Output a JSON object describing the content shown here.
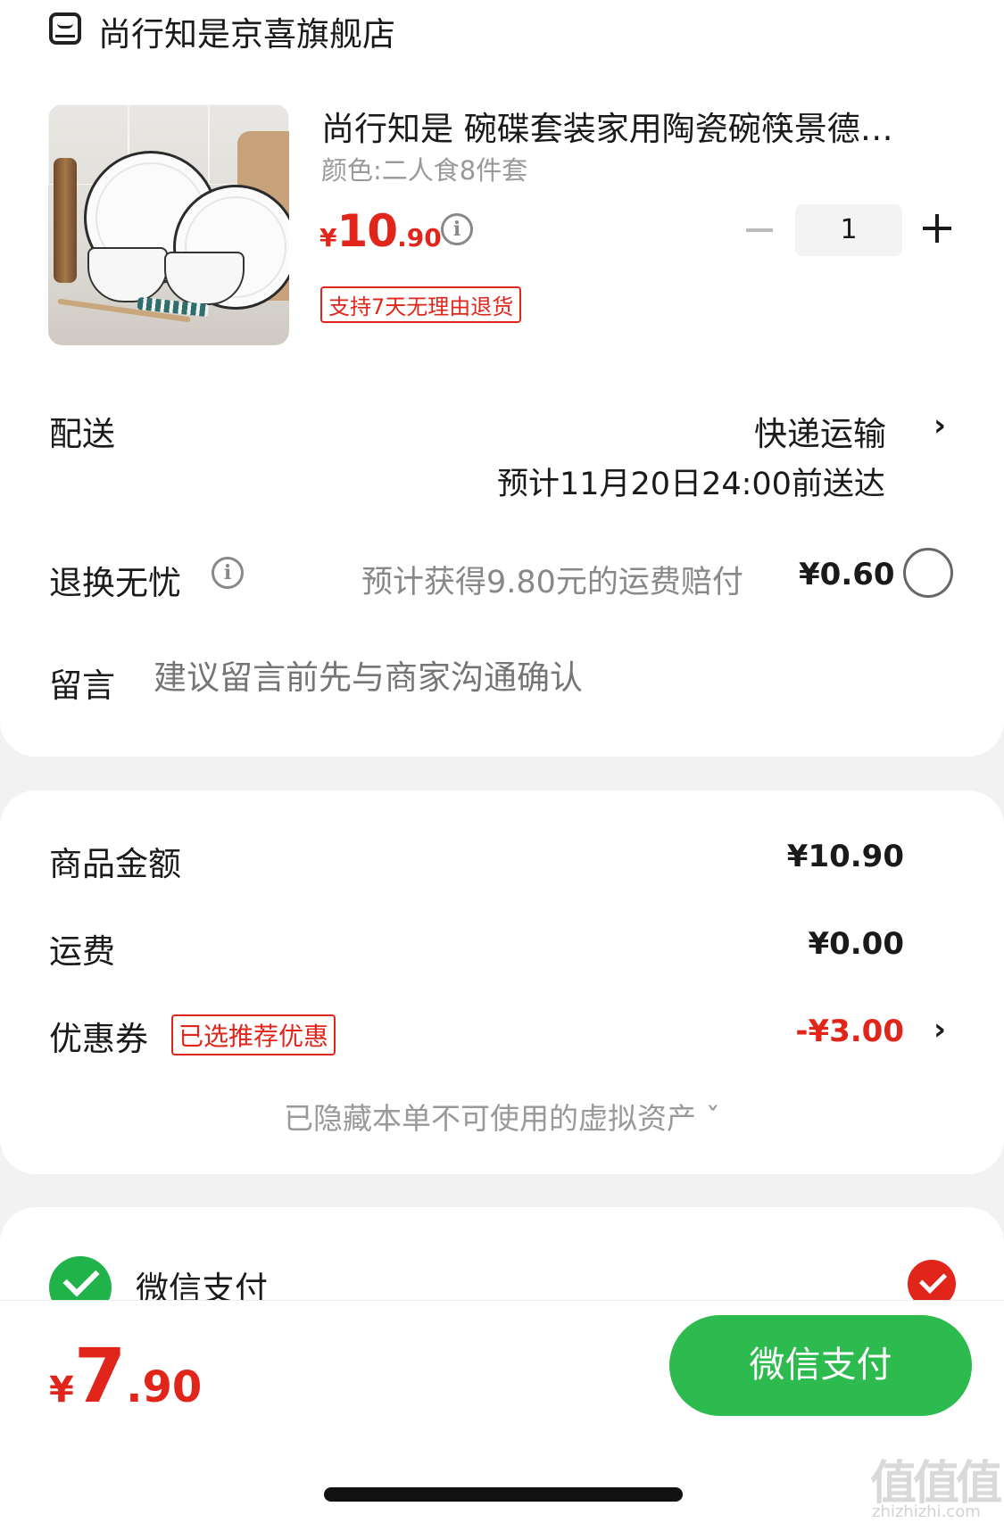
{
  "store": {
    "name": "尚行知是京喜旗舰店",
    "icon": "store-icon"
  },
  "product": {
    "title": "尚行知是 碗碟套装家用陶瓷碗筷景德…",
    "sku": "颜色:二人食8件套",
    "price_currency": "¥",
    "price_int": "10",
    "price_dec": ".90",
    "info_glyph": "i",
    "quantity": "1",
    "return_tag": "支持7天无理由退货"
  },
  "delivery": {
    "label": "配送",
    "method": "快递运输",
    "eta": "预计11月20日24:00前送达",
    "chevron": "›"
  },
  "return_worry_free": {
    "label": "退换无忧",
    "info_glyph": "i",
    "note": "预计获得9.80元的运费赔付",
    "fee": "¥0.60"
  },
  "message": {
    "label": "留言",
    "placeholder": "建议留言前先与商家沟通确认"
  },
  "summary": {
    "goods_label": "商品金额",
    "goods_value": "¥10.90",
    "shipping_label": "运费",
    "shipping_value": "¥0.00",
    "coupon_label": "优惠券",
    "coupon_tag": "已选推荐优惠",
    "coupon_value": "-¥3.00",
    "coupon_chevron": "›",
    "hidden_assets": "已隐藏本单不可使用的虚拟资产 ˇ"
  },
  "payment": {
    "method_label": "微信支付",
    "selected": true
  },
  "bottom": {
    "total_currency": "¥",
    "total_int": "7",
    "total_dec": ".90",
    "pay_button": "微信支付"
  },
  "watermark": {
    "main": "值值值",
    "sub": "zhizhizhi.com"
  },
  "colors": {
    "accent_red": "#e1251b",
    "wechat_green": "#2dba4e",
    "background": "#f2f2f2"
  }
}
